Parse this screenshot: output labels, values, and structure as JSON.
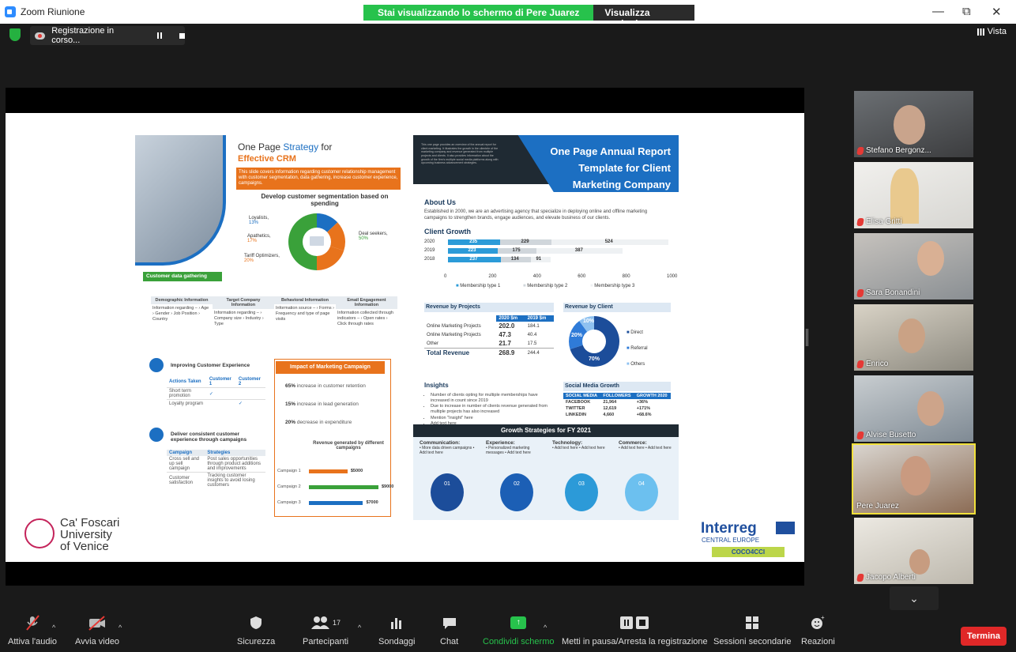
{
  "window": {
    "title": "Zoom Riunione",
    "share_banner": "Stai visualizzando lo schermo di Pere Juarez",
    "view_options": "Visualizza opzioni ⌄",
    "minimize": "—",
    "restore": "⧉",
    "close": "✕"
  },
  "recording": {
    "label": "Registrazione in corso..."
  },
  "view": {
    "label": "Vista"
  },
  "participants": [
    {
      "name": "Stefano Bergonz...",
      "muted": true
    },
    {
      "name": "Elisa Gritti",
      "muted": true
    },
    {
      "name": "Sara Bonandini",
      "muted": true
    },
    {
      "name": "Enrico",
      "muted": true
    },
    {
      "name": "Alvise Busetto",
      "muted": true
    },
    {
      "name": "Pere Juarez",
      "muted": false,
      "active": true
    },
    {
      "name": "Jacopo Alberti",
      "muted": true
    }
  ],
  "toolbar": {
    "audio": "Attiva l'audio",
    "video": "Avvia video",
    "security": "Sicurezza",
    "participants": "Partecipanti",
    "participants_count": "17",
    "polls": "Sondaggi",
    "chat": "Chat",
    "share": "Condividi schermo",
    "pause_rec": "Metti in pausa/Arresta la registrazione",
    "breakout": "Sessioni secondarie",
    "reactions": "Reazioni",
    "end": "Termina"
  },
  "left_slide": {
    "title_a": "One Page ",
    "title_b": "Strategy",
    "title_c": " for",
    "title_d": "Effective CRM",
    "orange_text": "This slide covers information regarding customer relationship management with customer segmentation, data gathering, increase customer experience, campaigns.",
    "seg_title": "Develop customer segmentation based on spending",
    "seg_loyalists": "Loyalists,",
    "seg_loyalists_v": "13%",
    "seg_apathetics": "Apathetics,",
    "seg_apathetics_v": "17%",
    "seg_tariff": "Tariff Optimizers,",
    "seg_tariff_v": "20%",
    "seg_deal": "Deal seekers,",
    "seg_deal_v": "50%",
    "gather_label": "Customer data gathering",
    "cols": [
      {
        "h": "Demographic Information",
        "t": "Information regarding – › Age › Gender › Job Position › Country"
      },
      {
        "h": "Target Company Information",
        "t": "Information regarding – › Company size › Industry › Type"
      },
      {
        "h": "Behavioral Information",
        "t": "Information source – › Forms › Frequency and type of page visits"
      },
      {
        "h": "Email Engagement Information",
        "t": "Information collected through indicators – › Open rates › Click through rates"
      }
    ],
    "improve_title": "Improving Customer Experience",
    "improve_head": [
      "Actions Taken",
      "Customer 1",
      "Customer 2"
    ],
    "improve_rows": [
      [
        "Short term promotion",
        "✓",
        ""
      ],
      [
        "Loyalty program",
        "",
        "✓"
      ]
    ],
    "deliver_title": "Deliver consistent customer experience through campaigns",
    "deliver_head": [
      "Campaign",
      "Strategies"
    ],
    "deliver_rows": [
      [
        "Cross sell and up sell campaign",
        "Post sales opportunities through product additions and improvements"
      ],
      [
        "Customer satisfaction",
        "Tracking customer insights to avoid losing customers"
      ]
    ],
    "impact_title": "Impact of Marketing Campaign",
    "impact": [
      {
        "v": "65%",
        "t": "increase in customer retention"
      },
      {
        "v": "15%",
        "t": "increase in lead generation"
      },
      {
        "v": "20%",
        "t": "decrease in expenditure"
      }
    ],
    "rev_gen_title": "Revenue generated by different campaigns",
    "campaigns": [
      {
        "label": "Campaign 1",
        "value": "$5000",
        "n": 5000,
        "color": "#e8731c"
      },
      {
        "label": "Campaign 2",
        "value": "$9000",
        "n": 9000,
        "color": "#3aa13a"
      },
      {
        "label": "Campaign 3",
        "value": "$7000",
        "n": 7000,
        "color": "#1c6fc2"
      }
    ],
    "uni_line1": "Ca' Foscari",
    "uni_line2": "University",
    "uni_line3": "of Venice"
  },
  "right_slide": {
    "intro": "This one page provides an overview of the annual report for client marketing. It illustrates the growth in the clientele of the marketing company and revenue generated from multiple projects and clients. It also provides information about the growth of the firm's multiple social media platforms along with upcoming business advancement strategies.",
    "title_l1": "One Page Annual Report",
    "title_l2": "Template for Client",
    "title_l3": "Marketing Company",
    "about_h": "About Us",
    "about_t": "Established in 2000, we are an advertising agency that specialize in deploying online and offline marketing campaigns to strengthen brands, engage audiences, and elevate business of our clients.",
    "growth_h": "Client Growth",
    "growth_axis": [
      "0",
      "200",
      "400",
      "600",
      "800",
      "1000"
    ],
    "growth_legend": [
      "Membership type 1",
      "Membership type 2",
      "Membership type 3"
    ],
    "revproj_h": "Revenue by Projects",
    "revproj_cols": [
      "2020 $m",
      "2019 $m"
    ],
    "revproj_rows": [
      [
        "Online Marketing Projects",
        "202.0",
        "184.1"
      ],
      [
        "Online Marketing Projects",
        "47.3",
        "40.4"
      ],
      [
        "Other",
        "21.7",
        "17.5"
      ]
    ],
    "revproj_total": [
      "Total Revenue",
      "268.9",
      "244.4"
    ],
    "revclient_h": "Revenue by Client",
    "revclient_legend": [
      "Direct",
      "Referral",
      "Others"
    ],
    "insights_h": "Insights",
    "insights": [
      "Number of clients opting for multiple memberships have increased in count since 2019",
      "Due to increase in number of clients revenue generated from multiple projects has also increased",
      "Mention \"Insight\" here",
      "Add text here"
    ],
    "social_h": "Social Media Growth",
    "social_cols": [
      "SOCIAL MEDIA",
      "FOLLOWERS",
      "GROWTH 2020"
    ],
    "social_rows": [
      [
        "FACEBOOK",
        "21,964",
        "+36%"
      ],
      [
        "TWITTER",
        "12,619",
        "+171%"
      ],
      [
        "LINKEDIN",
        "4,660",
        "+68.6%"
      ]
    ],
    "strategy_h": "Growth Strategies for FY 2021",
    "strategies": [
      {
        "h": "Communication:",
        "t": "• More data driven campaigns • Add text here",
        "n": "01"
      },
      {
        "h": "Experience:",
        "t": "• Personalized marketing messages • Add text here",
        "n": "02"
      },
      {
        "h": "Technology:",
        "t": "• Add text here • Add text here",
        "n": "03"
      },
      {
        "h": "Commerce:",
        "t": "• Add text here • Add text here",
        "n": "04"
      }
    ],
    "interreg": "Interreg",
    "interreg_sub": "CENTRAL EUROPE",
    "coco": "COCO4CCI"
  },
  "chart_data": [
    {
      "type": "bar",
      "title": "Client Growth",
      "categories": [
        "2020",
        "2019",
        "2018"
      ],
      "series": [
        {
          "name": "Membership type 1",
          "values": [
            235,
            223,
            237
          ]
        },
        {
          "name": "Membership type 2",
          "values": [
            229,
            175,
            134
          ]
        },
        {
          "name": "Membership type 3",
          "values": [
            524,
            387,
            91
          ]
        }
      ],
      "xlim": [
        0,
        1000
      ]
    },
    {
      "type": "pie",
      "title": "Revenue by Client",
      "categories": [
        "Direct",
        "Referral",
        "Others"
      ],
      "values": [
        70,
        20,
        10
      ],
      "value_labels": [
        "70%",
        "20%",
        "10%"
      ]
    },
    {
      "type": "pie",
      "categories": [
        "Loyalists",
        "Apathetics",
        "Tariff Optimizers",
        "Deal seekers"
      ],
      "values": [
        13,
        17,
        20,
        50
      ]
    }
  ],
  "colors": {
    "accent_blue": "#1c6fc2",
    "orange": "#e8731c",
    "green": "#3aa13a",
    "zoom_blue": "#2d8cff"
  }
}
